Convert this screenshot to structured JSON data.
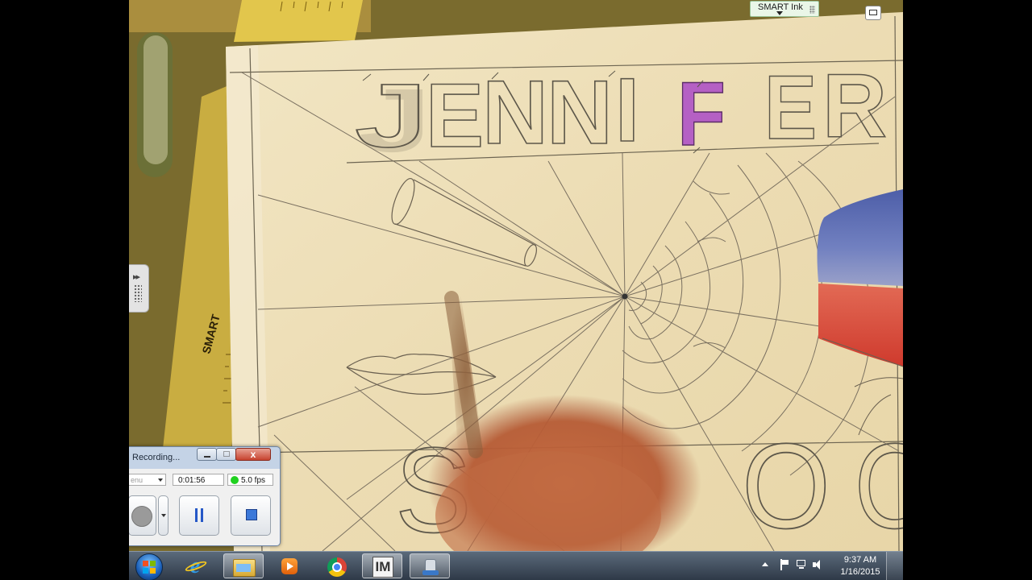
{
  "smart_ink": {
    "label": "SMART Ink"
  },
  "drawing": {
    "title_letters": [
      "J",
      "E",
      "N",
      "N",
      "I",
      "F",
      "E",
      "R"
    ],
    "bottom_letters": [
      "S",
      "O",
      "O"
    ],
    "ruler_text": "SMART"
  },
  "recorder": {
    "title": "Recording...",
    "source_value": "enu",
    "elapsed": "0:01:56",
    "fps": "5.0 fps",
    "close_glyph": "x"
  },
  "taskbar": {
    "apps": [
      "start",
      "internet-explorer",
      "windows-explorer",
      "media-player",
      "chrome",
      "im",
      "recorder"
    ],
    "im_label": "IM",
    "time": "9:37 AM",
    "date": "1/16/2015"
  },
  "colors": {
    "purple_letter": "#b560c4",
    "blue_shape": "#5c6fb8",
    "red_shape": "#d64a3e",
    "fps_indicator": "#1fd11f",
    "stop_button": "#3b78d9"
  }
}
